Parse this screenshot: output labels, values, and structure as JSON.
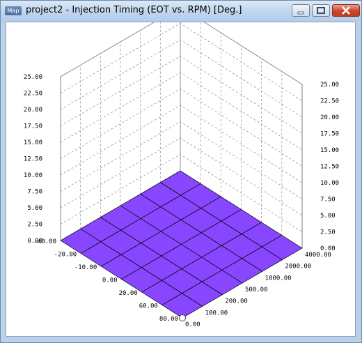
{
  "window": {
    "icon_text": "Map",
    "title": "project2 - Injection Timing (EOT vs. RPM) [Deg.]",
    "buttons": {
      "minimize": "minimize-icon",
      "maximize": "maximize-icon",
      "close": "close-icon"
    }
  },
  "chart_data": {
    "type": "surface3d",
    "title": "",
    "z_axis_ticks": [
      "25.00",
      "22.50",
      "20.00",
      "17.50",
      "15.00",
      "12.50",
      "10.00",
      "7.50",
      "5.00",
      "2.50",
      "0.00"
    ],
    "eot_axis_ticks": [
      "-40.00",
      "-20.00",
      "-10.00",
      "0.00",
      "20.00",
      "60.00",
      "80.00"
    ],
    "rpm_axis_ticks": [
      "0.00",
      "100.00",
      "200.00",
      "500.00",
      "1000.00",
      "2000.00",
      "4000.00"
    ],
    "eot": [
      -40,
      -20,
      -10,
      0,
      20,
      60,
      80
    ],
    "rpm": [
      0,
      100,
      200,
      500,
      1000,
      2000,
      4000
    ],
    "z": [
      [
        0,
        0,
        0,
        0,
        0,
        0,
        0
      ],
      [
        0,
        0,
        0,
        0,
        0,
        0,
        0
      ],
      [
        0,
        0,
        0,
        0,
        0,
        0,
        0
      ],
      [
        0,
        0,
        0,
        0,
        0,
        0,
        0
      ],
      [
        0,
        0,
        0,
        0,
        0,
        0,
        0
      ],
      [
        0,
        0,
        0,
        0,
        0,
        0,
        0
      ],
      [
        0,
        0,
        0,
        0,
        0,
        0,
        0
      ]
    ],
    "surface_points": [
      {
        "eot": -40,
        "rpm": 0,
        "z": 0
      },
      {
        "eot": -40,
        "rpm": 100,
        "z": 0
      },
      {
        "eot": -40,
        "rpm": 200,
        "z": 0
      },
      {
        "eot": -40,
        "rpm": 500,
        "z": 0
      },
      {
        "eot": -40,
        "rpm": 1000,
        "z": 0
      },
      {
        "eot": -40,
        "rpm": 2000,
        "z": 0
      },
      {
        "eot": -40,
        "rpm": 4000,
        "z": 0
      }
    ],
    "grid": true
  }
}
